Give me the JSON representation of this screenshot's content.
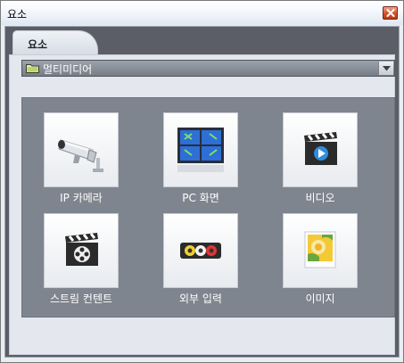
{
  "window": {
    "title": "요소"
  },
  "tab": {
    "label": "요소"
  },
  "dropdown": {
    "value": "멀티미디어",
    "icon": "folder-icon"
  },
  "items": [
    {
      "label": "IP 카메라",
      "icon": "ip-camera-icon"
    },
    {
      "label": "PC 화면",
      "icon": "pc-screen-icon"
    },
    {
      "label": "비디오",
      "icon": "video-icon"
    },
    {
      "label": "스트림 컨텐트",
      "icon": "stream-content-icon"
    },
    {
      "label": "외부 입력",
      "icon": "external-input-icon"
    },
    {
      "label": "이미지",
      "icon": "image-icon"
    }
  ],
  "colors": {
    "panel_bg": "#7f858e",
    "close_button": "#d6552e",
    "accent_blue": "#2d6fd6"
  }
}
